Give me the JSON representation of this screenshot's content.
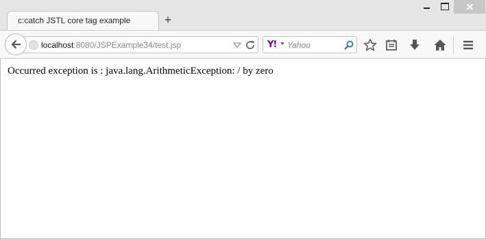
{
  "browser": {
    "tab": {
      "title": "c:catch JSTL core tag example"
    },
    "newtab_icon": "plus-icon",
    "url": {
      "host": "localhost",
      "path": ":8080/JSPExample34/test.jsp"
    },
    "search": {
      "engine_logo": "Y!",
      "placeholder": "Yahoo"
    },
    "icons": [
      "back-arrow-icon",
      "globe-icon",
      "dropdown-icon",
      "reload-icon",
      "search-icon",
      "star-icon",
      "reading-list-icon",
      "download-icon",
      "home-icon",
      "menu-icon",
      "minimize-icon",
      "maximize-icon",
      "close-icon"
    ]
  },
  "page": {
    "message": "Occurred exception is : java.lang.ArithmeticException: / by zero"
  }
}
